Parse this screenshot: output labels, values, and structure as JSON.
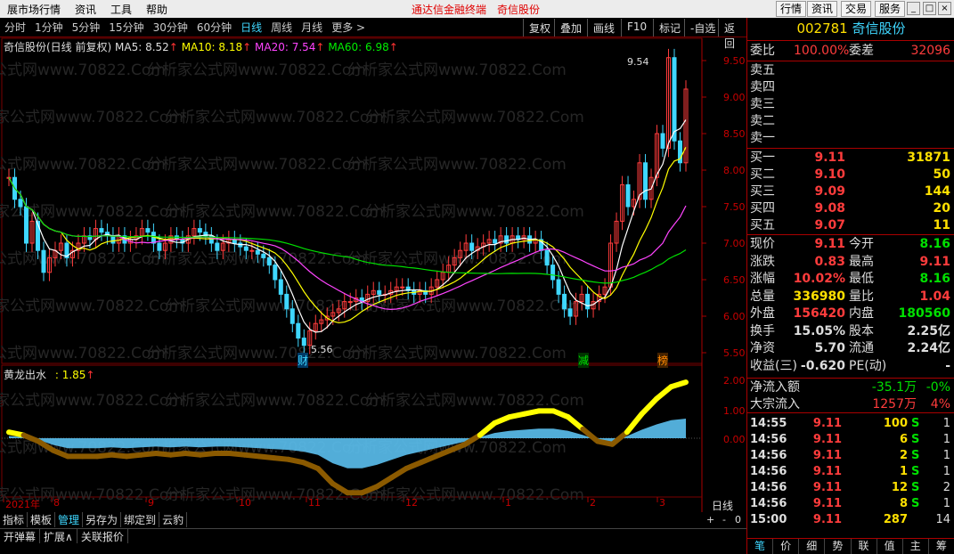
{
  "menubar": {
    "items": [
      "展市场行情",
      "资讯",
      "工具",
      "帮助"
    ],
    "center": [
      "通达信金融终端",
      "奇信股份"
    ],
    "right": [
      "行情",
      "资讯",
      "交易",
      "服务"
    ]
  },
  "toolbar": {
    "periods": [
      "分时",
      "1分钟",
      "5分钟",
      "15分钟",
      "30分钟",
      "60分钟",
      "日线",
      "周线",
      "月线",
      "更多 >"
    ],
    "active": "日线",
    "right": [
      "复权",
      "叠加",
      "画线",
      "F10",
      "标记",
      "-自选",
      "返回"
    ]
  },
  "main_chart": {
    "title": "奇信股份(日线 前复权)",
    "ma": [
      {
        "label": "MA5: 8.52",
        "color": "#ffffff"
      },
      {
        "label": "MA10: 8.18",
        "color": "#ffff00"
      },
      {
        "label": "MA20: 7.54",
        "color": "#ff44ff"
      },
      {
        "label": "MA60: 6.98",
        "color": "#00e000"
      }
    ],
    "high_label": "9.54",
    "low_label": "5.56",
    "y_ticks": [
      "9.50",
      "9.00",
      "8.50",
      "8.00",
      "7.50",
      "7.00",
      "6.50",
      "6.00",
      "5.50"
    ],
    "markers": [
      {
        "text": "财",
        "color": "#3fd7ff"
      },
      {
        "text": "减",
        "color": "#00e000"
      },
      {
        "text": "榜",
        "color": "#ff8800"
      }
    ]
  },
  "indicator": {
    "name": "黄龙出水",
    "value": ": 1.85",
    "y_ticks": [
      "2.00",
      "1.00",
      "0.00"
    ],
    "period": "日线",
    "zoom": [
      "+",
      "-",
      "0"
    ]
  },
  "x_axis": [
    "2021年",
    "8",
    "9",
    "10",
    "11",
    "12",
    "1",
    "2",
    "3"
  ],
  "watermark": "分析家公式网www.70822.Com",
  "bottom_tabs": [
    "指标",
    "模板",
    "管理",
    "另存为",
    "绑定到",
    "云豹"
  ],
  "bottom_tabs2": [
    "开弹幕",
    "扩展∧",
    "关联报价"
  ],
  "quote": {
    "code": "002781",
    "name": "奇信股份",
    "weibi_label": "委比",
    "weibi": "100.00%",
    "weicha_label": "委差",
    "weicha": "32096",
    "sells": [
      "卖五",
      "卖四",
      "卖三",
      "卖二",
      "卖一"
    ],
    "buys": [
      {
        "l": "买一",
        "p": "9.11",
        "v": "31871"
      },
      {
        "l": "买二",
        "p": "9.10",
        "v": "50"
      },
      {
        "l": "买三",
        "p": "9.09",
        "v": "144"
      },
      {
        "l": "买四",
        "p": "9.08",
        "v": "20"
      },
      {
        "l": "买五",
        "p": "9.07",
        "v": "11"
      }
    ],
    "stats": [
      {
        "l1": "现价",
        "v1": "9.11",
        "c1": "red",
        "l2": "今开",
        "v2": "8.16",
        "c2": "grn"
      },
      {
        "l1": "涨跌",
        "v1": "0.83",
        "c1": "red",
        "l2": "最高",
        "v2": "9.11",
        "c2": "red"
      },
      {
        "l1": "涨幅",
        "v1": "10.02%",
        "c1": "red",
        "l2": "最低",
        "v2": "8.16",
        "c2": "grn"
      },
      {
        "l1": "总量",
        "v1": "336980",
        "c1": "yel",
        "l2": "量比",
        "v2": "1.04",
        "c2": "red"
      },
      {
        "l1": "外盘",
        "v1": "156420",
        "c1": "red",
        "l2": "内盘",
        "v2": "180560",
        "c2": "grn"
      },
      {
        "l1": "换手",
        "v1": "15.05%",
        "c1": "wht",
        "l2": "股本",
        "v2": "2.25亿",
        "c2": "wht"
      },
      {
        "l1": "净资",
        "v1": "5.70",
        "c1": "wht",
        "l2": "流通",
        "v2": "2.24亿",
        "c2": "wht"
      },
      {
        "l1": "收益(三)",
        "v1": "-0.620",
        "c1": "wht",
        "l2": "PE(动)",
        "v2": "-",
        "c2": "wht"
      }
    ],
    "flows": [
      {
        "l": "净流入额",
        "v": "-35.1万",
        "p": "-0%",
        "c": "grn"
      },
      {
        "l": "大宗流入",
        "v": "1257万",
        "p": "4%",
        "c": "red"
      }
    ],
    "ticks": [
      {
        "t": "14:55",
        "p": "9.11",
        "v": "100",
        "s": "S",
        "n": "1"
      },
      {
        "t": "14:56",
        "p": "9.11",
        "v": "6",
        "s": "S",
        "n": "1"
      },
      {
        "t": "14:56",
        "p": "9.11",
        "v": "2",
        "s": "S",
        "n": "1"
      },
      {
        "t": "14:56",
        "p": "9.11",
        "v": "1",
        "s": "S",
        "n": "1"
      },
      {
        "t": "14:56",
        "p": "9.11",
        "v": "12",
        "s": "S",
        "n": "2"
      },
      {
        "t": "14:56",
        "p": "9.11",
        "v": "8",
        "s": "S",
        "n": "1"
      },
      {
        "t": "15:00",
        "p": "9.11",
        "v": "287",
        "s": "",
        "n": "14"
      }
    ],
    "bottom": [
      "笔",
      "价",
      "细",
      "势",
      "联",
      "值",
      "主",
      "筹"
    ]
  }
}
